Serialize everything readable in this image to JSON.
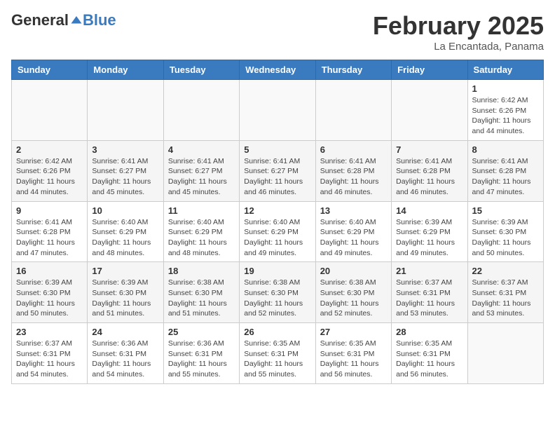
{
  "header": {
    "logo_general": "General",
    "logo_blue": "Blue",
    "month": "February 2025",
    "location": "La Encantada, Panama"
  },
  "days_of_week": [
    "Sunday",
    "Monday",
    "Tuesday",
    "Wednesday",
    "Thursday",
    "Friday",
    "Saturday"
  ],
  "weeks": [
    [
      {
        "day": "",
        "info": ""
      },
      {
        "day": "",
        "info": ""
      },
      {
        "day": "",
        "info": ""
      },
      {
        "day": "",
        "info": ""
      },
      {
        "day": "",
        "info": ""
      },
      {
        "day": "",
        "info": ""
      },
      {
        "day": "1",
        "info": "Sunrise: 6:42 AM\nSunset: 6:26 PM\nDaylight: 11 hours\nand 44 minutes."
      }
    ],
    [
      {
        "day": "2",
        "info": "Sunrise: 6:42 AM\nSunset: 6:26 PM\nDaylight: 11 hours\nand 44 minutes."
      },
      {
        "day": "3",
        "info": "Sunrise: 6:41 AM\nSunset: 6:27 PM\nDaylight: 11 hours\nand 45 minutes."
      },
      {
        "day": "4",
        "info": "Sunrise: 6:41 AM\nSunset: 6:27 PM\nDaylight: 11 hours\nand 45 minutes."
      },
      {
        "day": "5",
        "info": "Sunrise: 6:41 AM\nSunset: 6:27 PM\nDaylight: 11 hours\nand 46 minutes."
      },
      {
        "day": "6",
        "info": "Sunrise: 6:41 AM\nSunset: 6:28 PM\nDaylight: 11 hours\nand 46 minutes."
      },
      {
        "day": "7",
        "info": "Sunrise: 6:41 AM\nSunset: 6:28 PM\nDaylight: 11 hours\nand 46 minutes."
      },
      {
        "day": "8",
        "info": "Sunrise: 6:41 AM\nSunset: 6:28 PM\nDaylight: 11 hours\nand 47 minutes."
      }
    ],
    [
      {
        "day": "9",
        "info": "Sunrise: 6:41 AM\nSunset: 6:28 PM\nDaylight: 11 hours\nand 47 minutes."
      },
      {
        "day": "10",
        "info": "Sunrise: 6:40 AM\nSunset: 6:29 PM\nDaylight: 11 hours\nand 48 minutes."
      },
      {
        "day": "11",
        "info": "Sunrise: 6:40 AM\nSunset: 6:29 PM\nDaylight: 11 hours\nand 48 minutes."
      },
      {
        "day": "12",
        "info": "Sunrise: 6:40 AM\nSunset: 6:29 PM\nDaylight: 11 hours\nand 49 minutes."
      },
      {
        "day": "13",
        "info": "Sunrise: 6:40 AM\nSunset: 6:29 PM\nDaylight: 11 hours\nand 49 minutes."
      },
      {
        "day": "14",
        "info": "Sunrise: 6:39 AM\nSunset: 6:29 PM\nDaylight: 11 hours\nand 49 minutes."
      },
      {
        "day": "15",
        "info": "Sunrise: 6:39 AM\nSunset: 6:30 PM\nDaylight: 11 hours\nand 50 minutes."
      }
    ],
    [
      {
        "day": "16",
        "info": "Sunrise: 6:39 AM\nSunset: 6:30 PM\nDaylight: 11 hours\nand 50 minutes."
      },
      {
        "day": "17",
        "info": "Sunrise: 6:39 AM\nSunset: 6:30 PM\nDaylight: 11 hours\nand 51 minutes."
      },
      {
        "day": "18",
        "info": "Sunrise: 6:38 AM\nSunset: 6:30 PM\nDaylight: 11 hours\nand 51 minutes."
      },
      {
        "day": "19",
        "info": "Sunrise: 6:38 AM\nSunset: 6:30 PM\nDaylight: 11 hours\nand 52 minutes."
      },
      {
        "day": "20",
        "info": "Sunrise: 6:38 AM\nSunset: 6:30 PM\nDaylight: 11 hours\nand 52 minutes."
      },
      {
        "day": "21",
        "info": "Sunrise: 6:37 AM\nSunset: 6:31 PM\nDaylight: 11 hours\nand 53 minutes."
      },
      {
        "day": "22",
        "info": "Sunrise: 6:37 AM\nSunset: 6:31 PM\nDaylight: 11 hours\nand 53 minutes."
      }
    ],
    [
      {
        "day": "23",
        "info": "Sunrise: 6:37 AM\nSunset: 6:31 PM\nDaylight: 11 hours\nand 54 minutes."
      },
      {
        "day": "24",
        "info": "Sunrise: 6:36 AM\nSunset: 6:31 PM\nDaylight: 11 hours\nand 54 minutes."
      },
      {
        "day": "25",
        "info": "Sunrise: 6:36 AM\nSunset: 6:31 PM\nDaylight: 11 hours\nand 55 minutes."
      },
      {
        "day": "26",
        "info": "Sunrise: 6:35 AM\nSunset: 6:31 PM\nDaylight: 11 hours\nand 55 minutes."
      },
      {
        "day": "27",
        "info": "Sunrise: 6:35 AM\nSunset: 6:31 PM\nDaylight: 11 hours\nand 56 minutes."
      },
      {
        "day": "28",
        "info": "Sunrise: 6:35 AM\nSunset: 6:31 PM\nDaylight: 11 hours\nand 56 minutes."
      },
      {
        "day": "",
        "info": ""
      }
    ]
  ]
}
